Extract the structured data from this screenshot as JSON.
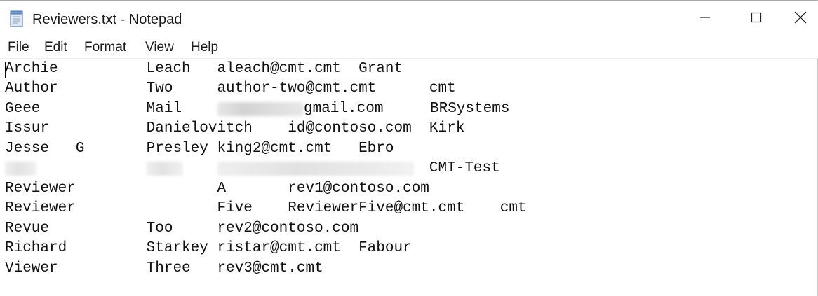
{
  "window": {
    "title": "Reviewers.txt - Notepad",
    "app_icon": "notepad-icon"
  },
  "caption_buttons": {
    "minimize": "minimize-icon",
    "maximize": "maximize-icon",
    "close": "close-icon"
  },
  "menu": [
    "File",
    "Edit",
    "Format",
    "View",
    "Help"
  ],
  "document": {
    "lines": [
      "Archie          Leach   aleach@cmt.cmt  Grant",
      "Author          Two     author-two@cmt.cmt      cmt",
      "Geee            Mail    ",
      "Issur           Danielovitch    id@contoso.com  Kirk",
      "Jesse   G       Presley king2@cmt.cmt   Ebro",
      "                                                CMT-Test",
      "Reviewer                A       rev1@contoso.com",
      "Reviewer                Five    ReviewerFive@cmt.cmt    cmt",
      "Revue           Too     rev2@contoso.com",
      "Richard         Starkey ristar@cmt.cmt  Fabour",
      "Viewer          Three   rev3@cmt.cmt"
    ],
    "line3_partial_email": "gmail.com",
    "line3_company": "BRSystems"
  }
}
